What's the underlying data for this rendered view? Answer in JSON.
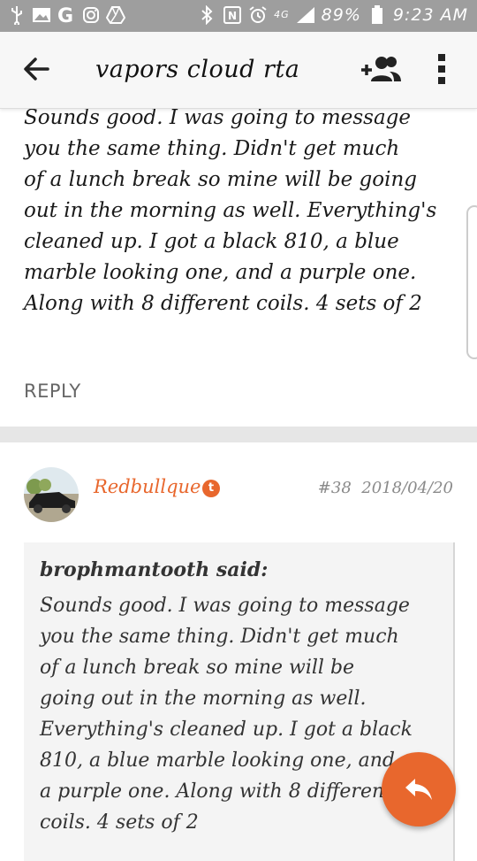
{
  "status_bar": {
    "battery": "89%",
    "time": "9:23 AM",
    "network": "4G",
    "icons": [
      "usb-icon",
      "gallery-icon",
      "google-icon",
      "instagram-icon",
      "drive-icon",
      "bluetooth-icon",
      "nfc-icon",
      "alarm-icon",
      "signal-icon",
      "battery-icon"
    ]
  },
  "header": {
    "title": "vapors cloud rta",
    "back_icon": "arrow-back-icon",
    "add_user_icon": "add-person-icon",
    "more_icon": "more-vertical-icon"
  },
  "message1": {
    "text": "Sounds good. I was going to message\nyou the same thing. Didn't get much\nof a lunch break so mine will be going\nout in the morning as well. Everything's\ncleaned up. I got a black 810, a blue\nmarble looking one, and a purple one.\nAlong with 8 different coils. 4 sets of 2",
    "reply_label": "REPLY"
  },
  "message2": {
    "author": "Redbullque",
    "badge": "t",
    "post_number": "#38",
    "date": "2018/04/20",
    "quote": {
      "author": "brophmantooth said:",
      "text": "Sounds good. I was going to message\nyou the same thing. Didn't get much\nof a lunch break so mine will be\ngoing out in the morning as well.\nEverything's cleaned up. I got a black\n810, a blue marble looking one, and\na purple one. Along with 8 different\ncoils. 4 sets of 2"
    }
  },
  "colors": {
    "accent": "#e8672d",
    "status_bar": "#9e9e9e",
    "app_bar": "#f7f7f7",
    "quote_bg": "#f4f4f4",
    "separator": "#e6e6e6"
  },
  "fab": {
    "icon": "reply-icon"
  }
}
